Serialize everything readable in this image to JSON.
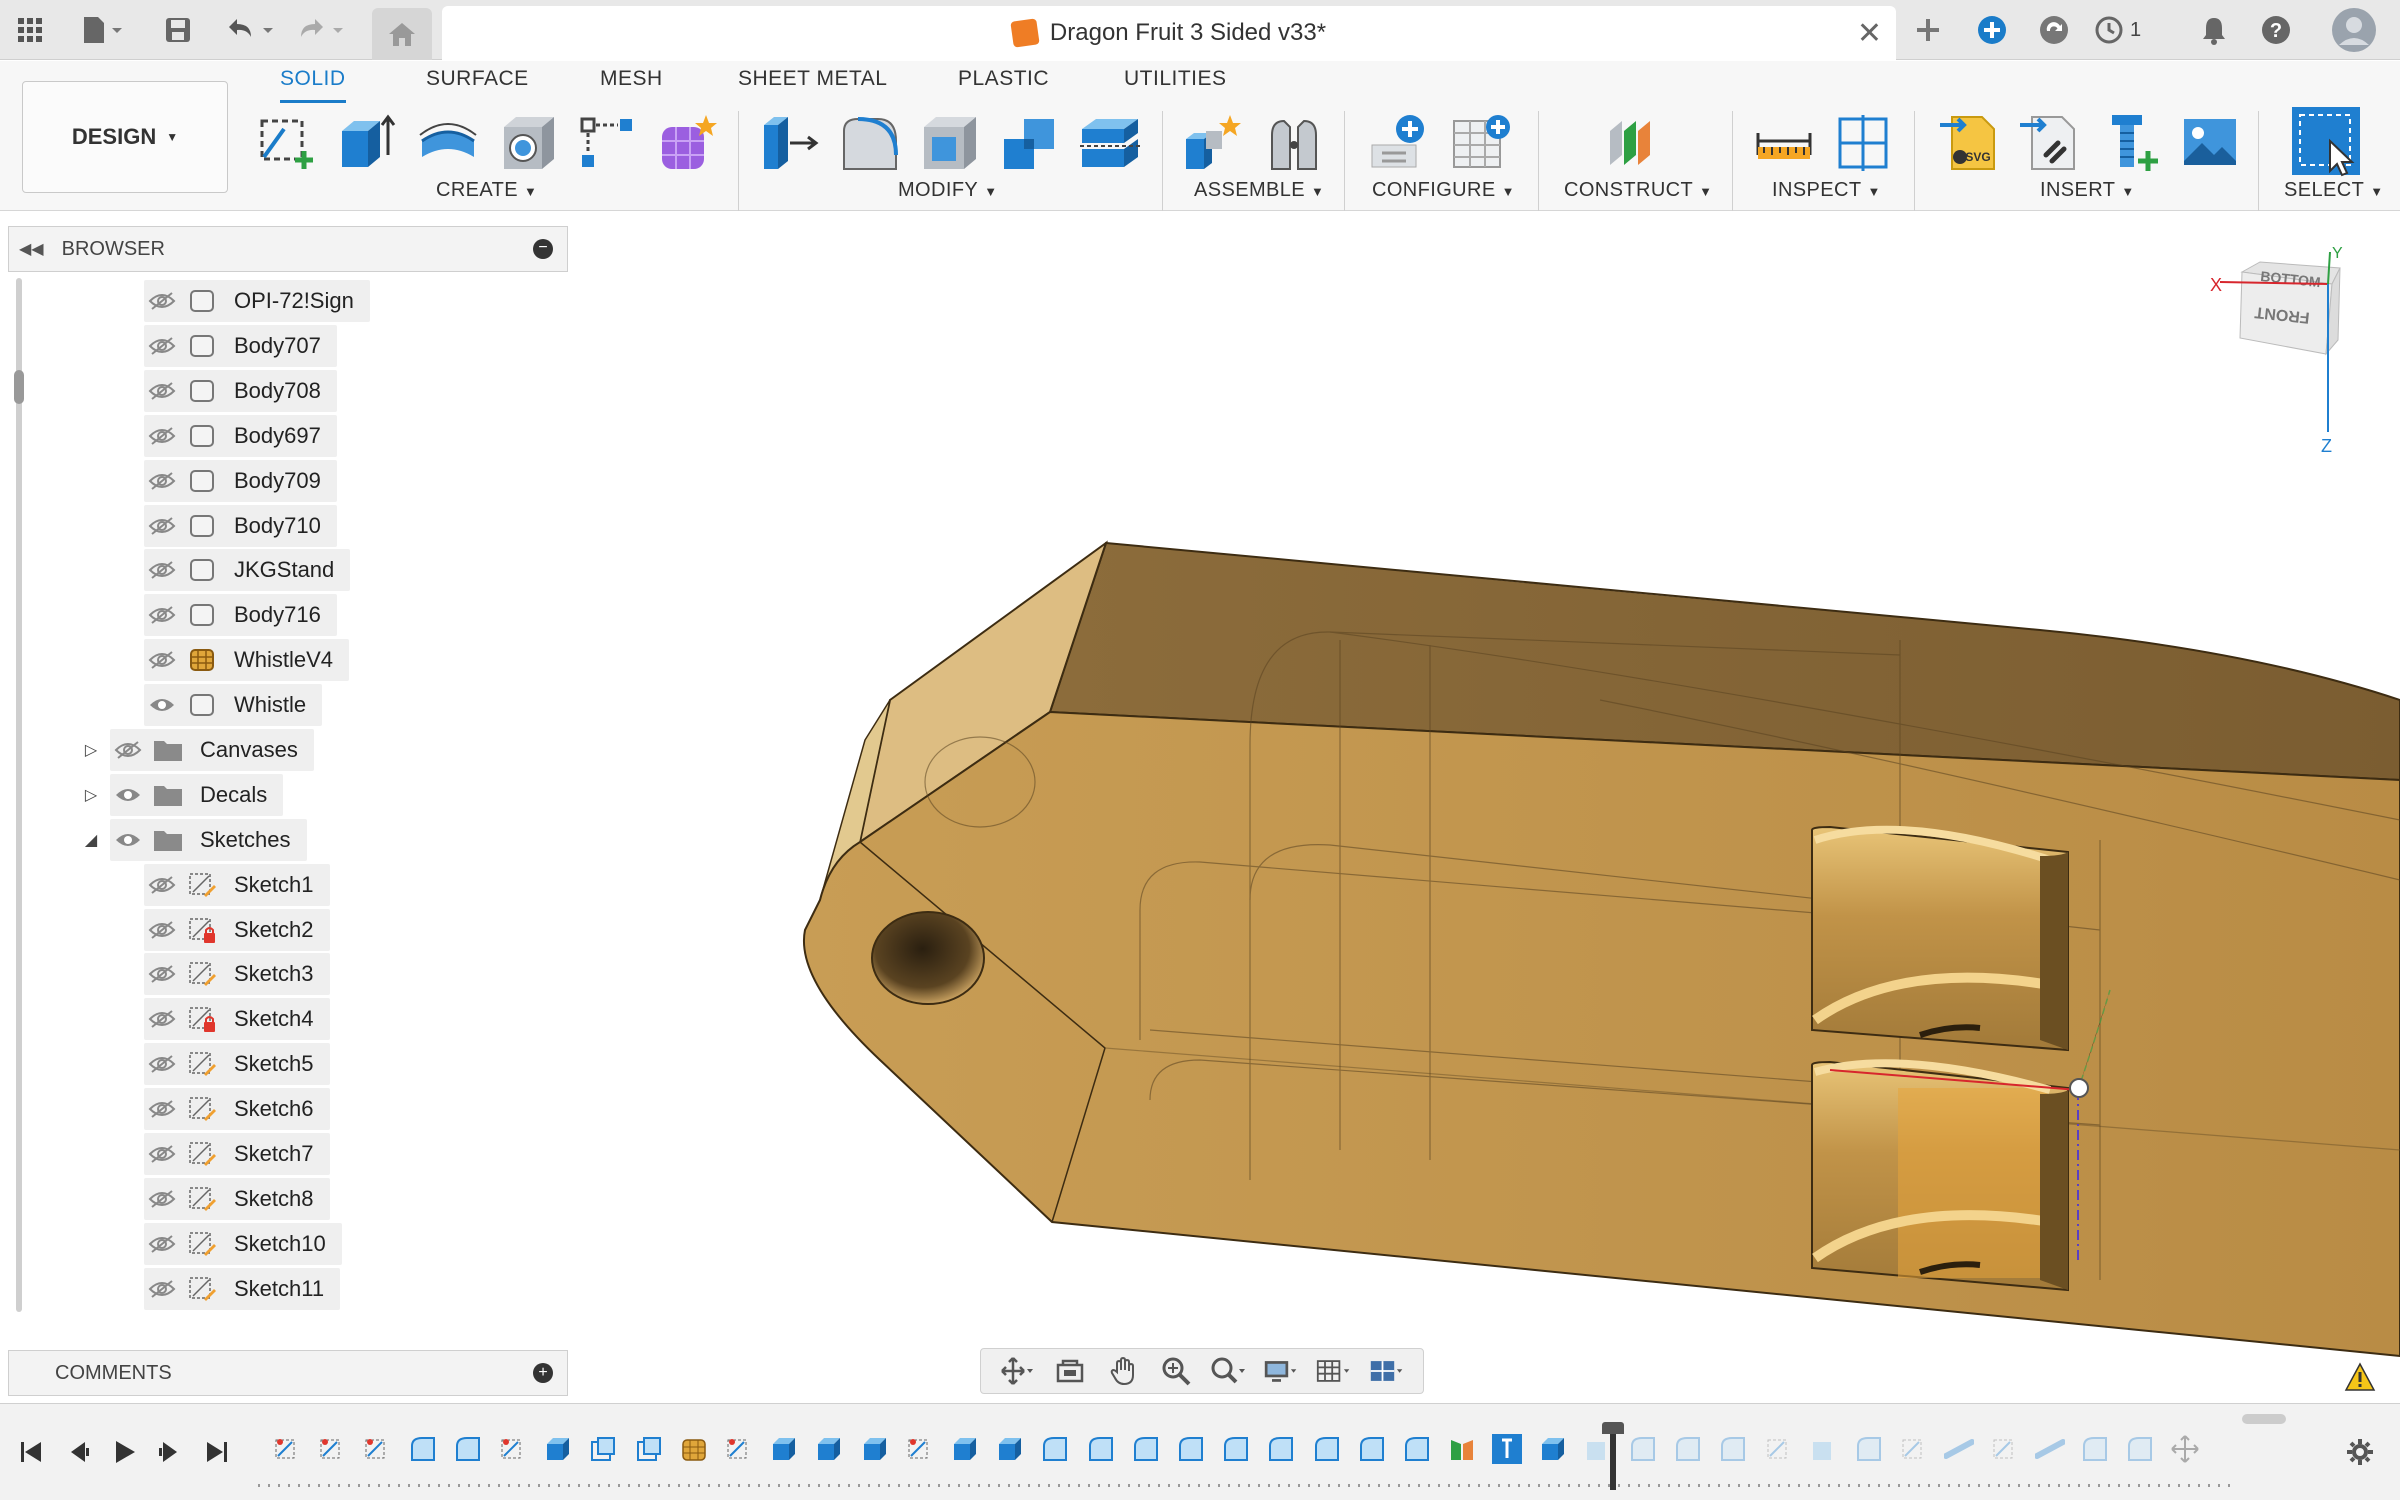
{
  "document": {
    "title": "Dragon Fruit 3 Sided v33*"
  },
  "appbar": {
    "job_count": "1"
  },
  "workspace": {
    "label": "DESIGN"
  },
  "tabs": [
    {
      "label": "SOLID",
      "active": true
    },
    {
      "label": "SURFACE"
    },
    {
      "label": "MESH"
    },
    {
      "label": "SHEET METAL"
    },
    {
      "label": "PLASTIC"
    },
    {
      "label": "UTILITIES"
    }
  ],
  "groups": {
    "create": "CREATE",
    "modify": "MODIFY",
    "assemble": "ASSEMBLE",
    "configure": "CONFIGURE",
    "construct": "CONSTRUCT",
    "inspect": "INSPECT",
    "insert": "INSERT",
    "select": "SELECT"
  },
  "browser": {
    "title": "BROWSER",
    "items": [
      {
        "label": "OPI-72!Sign",
        "visible": false,
        "type": "body"
      },
      {
        "label": "Body707",
        "visible": false,
        "type": "body"
      },
      {
        "label": "Body708",
        "visible": false,
        "type": "body"
      },
      {
        "label": "Body697",
        "visible": false,
        "type": "body"
      },
      {
        "label": "Body709",
        "visible": false,
        "type": "body"
      },
      {
        "label": "Body710",
        "visible": false,
        "type": "body"
      },
      {
        "label": "JKGStand",
        "visible": false,
        "type": "body"
      },
      {
        "label": "Body716",
        "visible": false,
        "type": "body"
      },
      {
        "label": "WhistleV4",
        "visible": false,
        "type": "body-mesh"
      },
      {
        "label": "Whistle",
        "visible": true,
        "type": "body"
      }
    ],
    "folders": [
      {
        "label": "Canvases",
        "visible": false,
        "expanded": false
      },
      {
        "label": "Decals",
        "visible": true,
        "expanded": false
      },
      {
        "label": "Sketches",
        "visible": true,
        "expanded": true
      }
    ],
    "sketches": [
      {
        "label": "Sketch1",
        "visible": false,
        "locked": false
      },
      {
        "label": "Sketch2",
        "visible": false,
        "locked": true
      },
      {
        "label": "Sketch3",
        "visible": false,
        "locked": false
      },
      {
        "label": "Sketch4",
        "visible": false,
        "locked": true
      },
      {
        "label": "Sketch5",
        "visible": false,
        "locked": false
      },
      {
        "label": "Sketch6",
        "visible": false,
        "locked": false
      },
      {
        "label": "Sketch7",
        "visible": false,
        "locked": false
      },
      {
        "label": "Sketch8",
        "visible": false,
        "locked": false
      },
      {
        "label": "Sketch10",
        "visible": false,
        "locked": false
      },
      {
        "label": "Sketch11",
        "visible": false,
        "locked": false
      }
    ]
  },
  "comments": {
    "title": "COMMENTS"
  },
  "viewcube": {
    "face_top": "BOTTOM",
    "face_front": "FRONT",
    "axis_x": "X",
    "axis_y": "Y",
    "axis_z": "Z"
  },
  "colors": {
    "accent": "#1a7cc9",
    "model": "#c3974e",
    "model_dark": "#8b6d3e",
    "model_light": "#dcbd86"
  }
}
